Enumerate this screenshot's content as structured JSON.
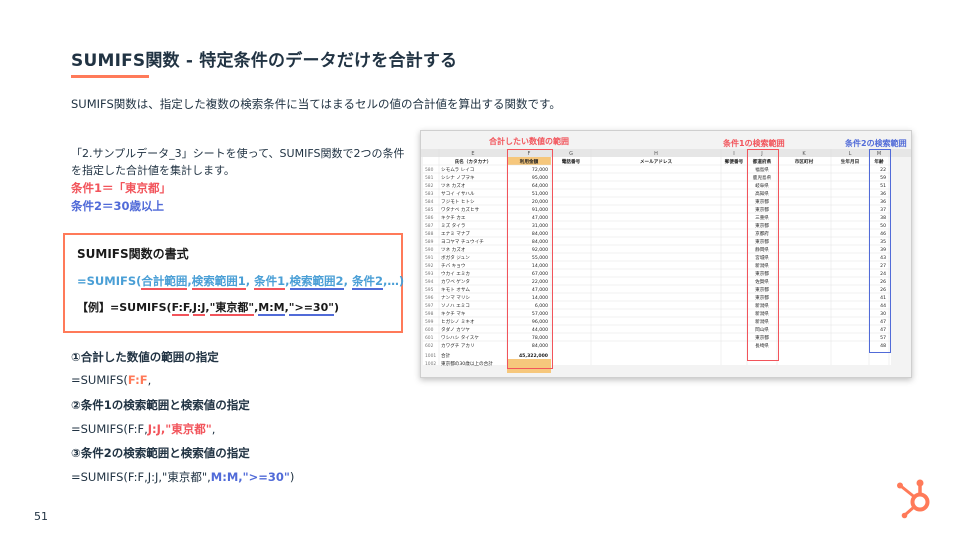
{
  "slide": {
    "title": "SUMIFS関数 - 特定条件のデータだけを合計する",
    "intro": "SUMIFS関数は、指定した複数の検索条件に当てはまるセルの値の合計値を算出する関数です。",
    "description": "「2.サンプルデータ_3」シートを使って、SUMIFS関数で2つの条件を指定した合計値を集計します。",
    "condition1": "条件1＝「東京都」",
    "condition2": "条件2＝30歳以上",
    "page_number": "51"
  },
  "syntax": {
    "title": "SUMIFS関数の書式",
    "formula_prefix": "=SUMIFS(",
    "arg_sum": "合計範囲",
    "arg_range1": "検索範囲1",
    "arg_cond1": "条件1",
    "arg_range2": "検索範囲2",
    "arg_cond2": "条件2",
    "formula_suffix": "…)",
    "sep": ",",
    "example_prefix": "【例】=SUMIFS(",
    "ex_sum": "F:F",
    "ex_range1": "J:J",
    "ex_cond1": "\"東京都\"",
    "ex_range2": "M:M",
    "ex_cond2": "\">=30\"",
    "example_suffix": ")"
  },
  "steps": {
    "s1_heading": "①合計した数値の範囲の指定",
    "s1_prefix": "=SUMIFS(",
    "s1_hl": "F:F",
    "s1_suffix": ",",
    "s2_heading": "②条件1の検索範囲と検索値の指定",
    "s2_prefix": "=SUMIFS(F:F,",
    "s2_hl": "J:J,\"東京都\"",
    "s2_suffix": ",",
    "s3_heading": "③条件2の検索範囲と検索値の指定",
    "s3_prefix": "=SUMIFS(F:F,J:J,\"東京都\",",
    "s3_hl": "M:M,\">=30\"",
    "s3_suffix": ")"
  },
  "sheet": {
    "annotation_sum": "合計したい数値の範囲",
    "annotation_cond1": "条件1の検索範囲",
    "annotation_cond2": "条件2の検索範囲",
    "column_letters": [
      "E",
      "F",
      "G",
      "H",
      "I",
      "J",
      "K",
      "L",
      "M"
    ],
    "headers": [
      "氏名（カタカナ）",
      "利用金額",
      "電話番号",
      "メールアドレス",
      "郵便番号",
      "都道府県",
      "市区町村",
      "生年月日",
      "年齢"
    ],
    "rows": [
      {
        "no": "580",
        "name": "シモムラ レイコ",
        "amount": "72,000",
        "pref": "福島県",
        "age": "22"
      },
      {
        "no": "581",
        "name": "シシナ ノブヲキ",
        "amount": "95,000",
        "pref": "鹿児島県",
        "age": "59"
      },
      {
        "no": "582",
        "name": "ツネ カズオ",
        "amount": "64,000",
        "pref": "岐阜県",
        "age": "51"
      },
      {
        "no": "583",
        "name": "サコイ イサハル",
        "amount": "51,000",
        "pref": "高知県",
        "age": "36"
      },
      {
        "no": "584",
        "name": "フジモト ヒトシ",
        "amount": "20,000",
        "pref": "東京都",
        "age": "36"
      },
      {
        "no": "585",
        "name": "ワタナベ カズヒサ",
        "amount": "91,000",
        "pref": "東京都",
        "age": "37"
      },
      {
        "no": "586",
        "name": "キクチ カエ",
        "amount": "47,000",
        "pref": "三重県",
        "age": "38"
      },
      {
        "no": "587",
        "name": "ミズ タイラ",
        "amount": "31,000",
        "pref": "東京都",
        "age": "50"
      },
      {
        "no": "588",
        "name": "エナミ マナブ",
        "amount": "84,000",
        "pref": "京都府",
        "age": "46"
      },
      {
        "no": "589",
        "name": "ヨコヤマ チュウイチ",
        "amount": "84,000",
        "pref": "東京都",
        "age": "35"
      },
      {
        "no": "590",
        "name": "ツネ カズオ",
        "amount": "92,000",
        "pref": "静岡県",
        "age": "39"
      },
      {
        "no": "591",
        "name": "ボガタ ジュン",
        "amount": "55,000",
        "pref": "宮城県",
        "age": "43"
      },
      {
        "no": "592",
        "name": "チバ キョウ",
        "amount": "14,000",
        "pref": "新潟県",
        "age": "27"
      },
      {
        "no": "593",
        "name": "ウカイ エミカ",
        "amount": "67,000",
        "pref": "東京都",
        "age": "24"
      },
      {
        "no": "594",
        "name": "カワベ ゲンタ",
        "amount": "22,000",
        "pref": "佐賀県",
        "age": "26"
      },
      {
        "no": "595",
        "name": "キモト オサム",
        "amount": "47,000",
        "pref": "東京都",
        "age": "26"
      },
      {
        "no": "596",
        "name": "ナンマ マリシ",
        "amount": "14,000",
        "pref": "東京都",
        "age": "41"
      },
      {
        "no": "597",
        "name": "ソノハ エミコ",
        "amount": "6,000",
        "pref": "新潟県",
        "age": "44"
      },
      {
        "no": "598",
        "name": "キクチ マキ",
        "amount": "57,000",
        "pref": "新潟県",
        "age": "30"
      },
      {
        "no": "599",
        "name": "ヒガシノ ミキオ",
        "amount": "96,000",
        "pref": "新潟県",
        "age": "47"
      },
      {
        "no": "600",
        "name": "タダノ カツヤ",
        "amount": "44,000",
        "pref": "岡山県",
        "age": "47"
      },
      {
        "no": "601",
        "name": "ワシハシ タイスケ",
        "amount": "78,000",
        "pref": "東京都",
        "age": "57"
      },
      {
        "no": "602",
        "name": "カワグチ アカリ",
        "amount": "84,000",
        "pref": "長崎県",
        "age": "48"
      }
    ],
    "total_row_no": "1001",
    "total_label": "合計",
    "total_value": "45,322,000",
    "criteria_row_no": "1002",
    "criteria_label": "東京都の30歳以上の合計"
  },
  "colors": {
    "accent": "#ff7a59",
    "red": "#f2545b",
    "blue": "#516bd8",
    "text": "#213343"
  },
  "icons": {
    "logo": "hubspot-sprocket-icon"
  }
}
